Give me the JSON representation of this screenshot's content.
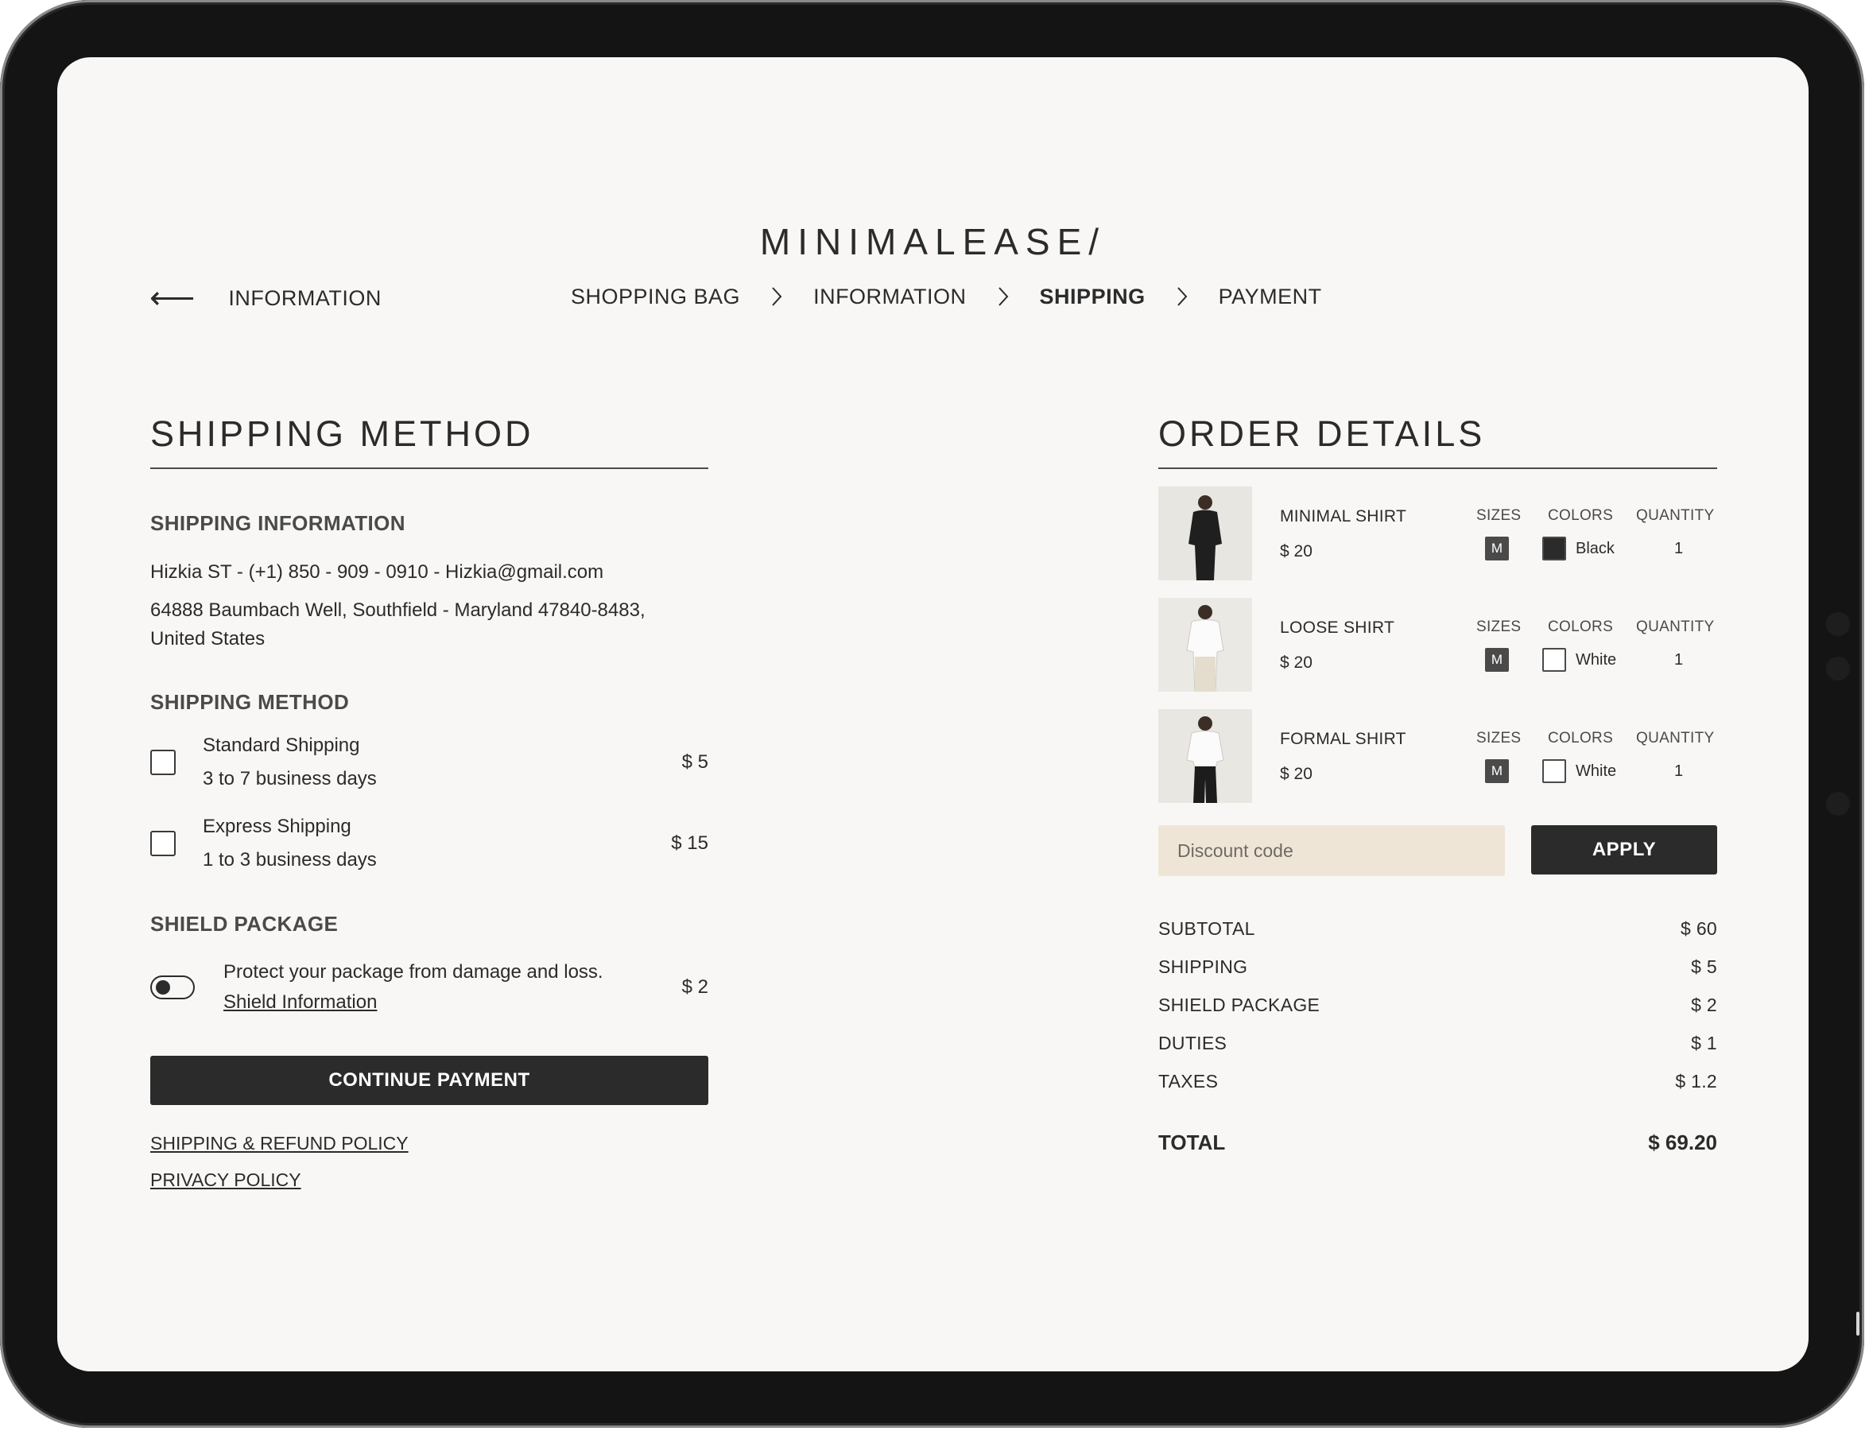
{
  "brand": {
    "logo": "MINIMALEASE/"
  },
  "nav": {
    "back_label": "INFORMATION",
    "breadcrumbs": [
      {
        "label": "SHOPPING BAG"
      },
      {
        "label": "INFORMATION"
      },
      {
        "label": "SHIPPING",
        "active": true
      },
      {
        "label": "PAYMENT"
      }
    ]
  },
  "shipping": {
    "title": "SHIPPING METHOD",
    "info_heading": "SHIPPING INFORMATION",
    "contact_line": "Hizkia ST - (+1) 850 - 909 - 0910 - Hizkia@gmail.com",
    "address_line1": "64888 Baumbach Well, Southfield - Maryland 47840-8483,",
    "address_line2": "United States",
    "method_heading": "SHIPPING METHOD",
    "options": [
      {
        "name": "Standard Shipping",
        "duration": "3 to 7 business days",
        "price": "$ 5",
        "checked": false
      },
      {
        "name": "Express Shipping",
        "duration": "1 to 3 business days",
        "price": "$ 15",
        "checked": false
      }
    ],
    "shield_heading": "SHIELD PACKAGE",
    "shield_text": "Protect your package from damage and loss.",
    "shield_link": "Shield Information",
    "shield_price": "$ 2",
    "shield_enabled": false,
    "continue_label": "CONTINUE PAYMENT",
    "refund_policy": "SHIPPING & REFUND POLICY",
    "privacy_policy": "PRIVACY POLICY"
  },
  "order": {
    "title": "ORDER DETAILS",
    "columns": {
      "sizes": "SIZES",
      "colors": "COLORS",
      "quantity": "QUANTITY"
    },
    "items": [
      {
        "name": "MINIMAL SHIRT",
        "price": "$ 20",
        "size": "M",
        "color": "Black",
        "color_hex": "#2b2b2b",
        "quantity": "1"
      },
      {
        "name": "LOOSE SHIRT",
        "price": "$ 20",
        "size": "M",
        "color": "White",
        "color_hex": "#ffffff",
        "quantity": "1"
      },
      {
        "name": "FORMAL SHIRT",
        "price": "$ 20",
        "size": "M",
        "color": "White",
        "color_hex": "#ffffff",
        "quantity": "1"
      }
    ],
    "discount_placeholder": "Discount code",
    "apply_label": "APPLY",
    "summary": [
      {
        "label": "SUBTOTAL",
        "value": "$ 60"
      },
      {
        "label": "SHIPPING",
        "value": "$ 5"
      },
      {
        "label": "SHIELD PACKAGE",
        "value": "$ 2"
      },
      {
        "label": "DUTIES",
        "value": "$ 1"
      },
      {
        "label": "TAXES",
        "value": "$ 1.2"
      }
    ],
    "total_label": "TOTAL",
    "total_value": "$ 69.20"
  },
  "colors": {
    "accent_dark": "#2b2b2b",
    "discount_bg": "#efe5d6",
    "page_bg": "#f8f7f5"
  }
}
